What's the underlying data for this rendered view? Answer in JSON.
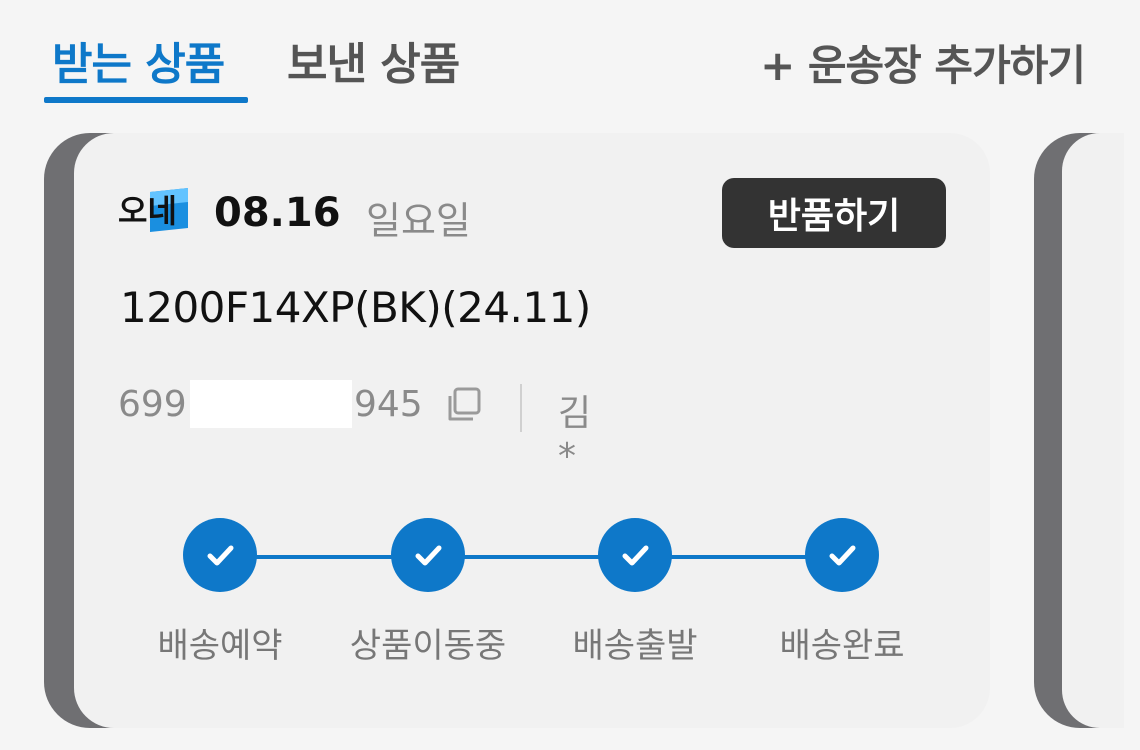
{
  "tabs": {
    "received": "받는 상품",
    "sent": "보낸 상품",
    "add_waybill": "+ 운송장 추가하기"
  },
  "card": {
    "carrier_logo": "오네",
    "date": "08.16",
    "weekday": "일요일",
    "return_button": "반품하기",
    "product": "1200F14XP(BK)(24.11)",
    "tracking_prefix": "699",
    "tracking_suffix": "945",
    "recipient": "김*",
    "icons": {
      "copy": "copy-icon",
      "check": "check-icon"
    },
    "steps": [
      {
        "label": "배송예약",
        "done": true
      },
      {
        "label": "상품이동중",
        "done": true
      },
      {
        "label": "배송출발",
        "done": true
      },
      {
        "label": "배송완료",
        "done": true
      }
    ]
  },
  "colors": {
    "accent": "#0e78c9",
    "dark_button": "#333333",
    "card_edge": "#6f6f72",
    "muted_text": "#8a8a8a"
  }
}
